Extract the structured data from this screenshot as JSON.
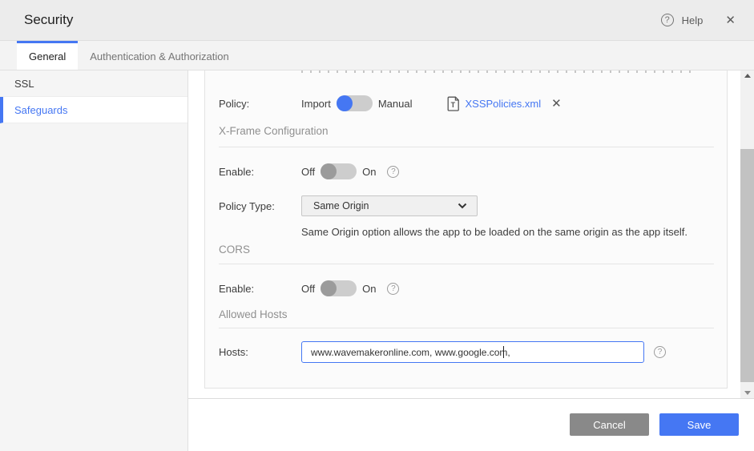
{
  "header": {
    "title": "Security",
    "help_label": "Help"
  },
  "icons": {
    "question_glyph": "?",
    "close_glyph": "✕",
    "remove_glyph": "✕"
  },
  "tabs": [
    {
      "label": "General",
      "active": true
    },
    {
      "label": "Authentication & Authorization",
      "active": false
    }
  ],
  "sidebar": {
    "items": [
      {
        "label": "SSL",
        "active": false
      },
      {
        "label": "Safeguards",
        "active": true
      }
    ]
  },
  "panel": {
    "policy_row": {
      "label": "Policy:",
      "option_left": "Import",
      "option_right": "Manual",
      "selected": "Import",
      "file_name": "XSSPolicies.xml"
    },
    "xframe": {
      "title": "X-Frame Configuration",
      "enable_label": "Enable:",
      "off_label": "Off",
      "on_label": "On",
      "enabled": false,
      "policy_type_label": "Policy Type:",
      "policy_type_value": "Same Origin",
      "helper_text": "Same Origin option allows the app to be loaded on the same origin as the app itself."
    },
    "cors": {
      "title": "CORS",
      "enable_label": "Enable:",
      "off_label": "Off",
      "on_label": "On",
      "enabled": false
    },
    "allowed_hosts": {
      "title": "Allowed Hosts",
      "hosts_label": "Hosts:",
      "hosts_value": "www.wavemakeronline.com, www.google.com, "
    }
  },
  "footer": {
    "cancel_label": "Cancel",
    "save_label": "Save"
  },
  "colors": {
    "accent": "#4577f3",
    "link": "#4577f3",
    "cancel_button": "#898989",
    "header_bg": "#ececec",
    "sidebar_bg": "#f5f5f5"
  }
}
